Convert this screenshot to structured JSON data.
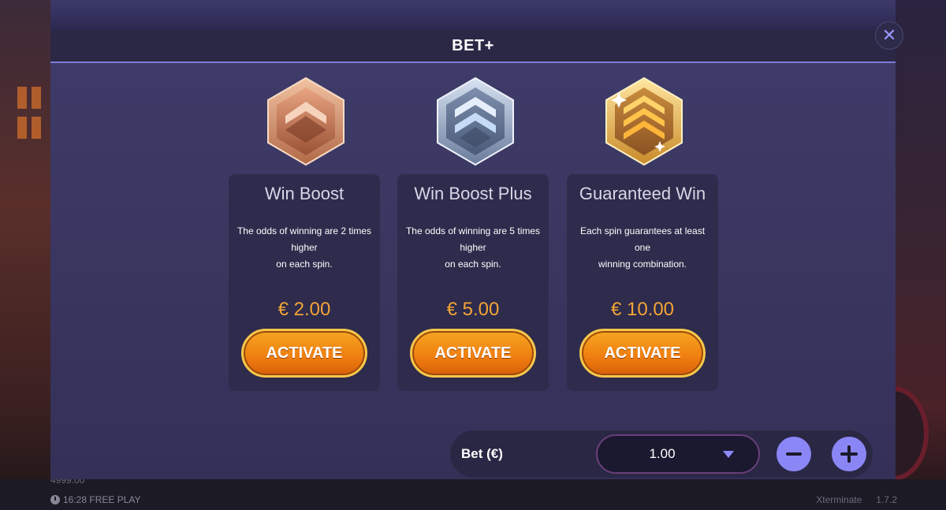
{
  "modal": {
    "title": "BET+",
    "close_icon": "close-icon"
  },
  "options": [
    {
      "title": "Win Boost",
      "description_line1": "The odds of winning are 2 times higher",
      "description_line2": "on each spin.",
      "price": "€ 2.00",
      "button": "ACTIVATE",
      "badge_icon": "bronze-chevron-badge-icon",
      "badge_color": "#c97a55"
    },
    {
      "title": "Win Boost Plus",
      "description_line1": "The odds of winning are 5 times higher",
      "description_line2": "on each spin.",
      "price": "€ 5.00",
      "button": "ACTIVATE",
      "badge_icon": "silver-chevron-badge-icon",
      "badge_color": "#8a9bb8"
    },
    {
      "title": "Guaranteed Win",
      "description_line1": "Each spin guarantees at least one",
      "description_line2": "winning combination.",
      "price": "€ 10.00",
      "button": "ACTIVATE",
      "badge_icon": "gold-chevron-badge-icon",
      "badge_color": "#e0a040"
    }
  ],
  "bet": {
    "label": "Bet (€)",
    "value": "1.00"
  },
  "footer": {
    "balance": "4999.00",
    "time_mode": "16:28 FREE PLAY",
    "game_name": "Xterminate",
    "version": "1.7.2"
  },
  "colors": {
    "accent": "#8a86f5",
    "price": "#f3a436",
    "button": "#ef7d0f"
  }
}
